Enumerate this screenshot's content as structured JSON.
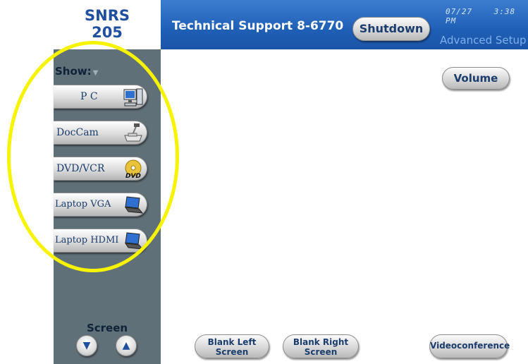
{
  "room": {
    "line1": "SNRS",
    "line2": "205"
  },
  "header": {
    "support_label": "Technical Support 8-6770",
    "shutdown_label": "Shutdown",
    "date": "07/27",
    "time": "3:38 PM",
    "advanced_setup": "Advanced Setup"
  },
  "sidebar": {
    "show_label": "Show:",
    "sources": [
      {
        "label": "P C",
        "icon": "pc-icon"
      },
      {
        "label": "DocCam",
        "icon": "document-camera-icon"
      },
      {
        "label": "DVD/VCR",
        "icon": "dvd-icon"
      },
      {
        "label": "Laptop VGA",
        "icon": "laptop-icon"
      },
      {
        "label": "Laptop HDMI",
        "icon": "laptop-icon"
      }
    ],
    "screen_label": "Screen"
  },
  "main": {
    "volume_label": "Volume",
    "blank_left": {
      "line1": "Blank Left",
      "line2": "Screen"
    },
    "blank_right": {
      "line1": "Blank Right",
      "line2": "Screen"
    },
    "videoconference": "Videoconference"
  },
  "colors": {
    "header_blue": "#1f5fb6",
    "sidebar_gray": "#607078",
    "label_blue": "#1a3d6d",
    "highlight": "#f6f400"
  }
}
